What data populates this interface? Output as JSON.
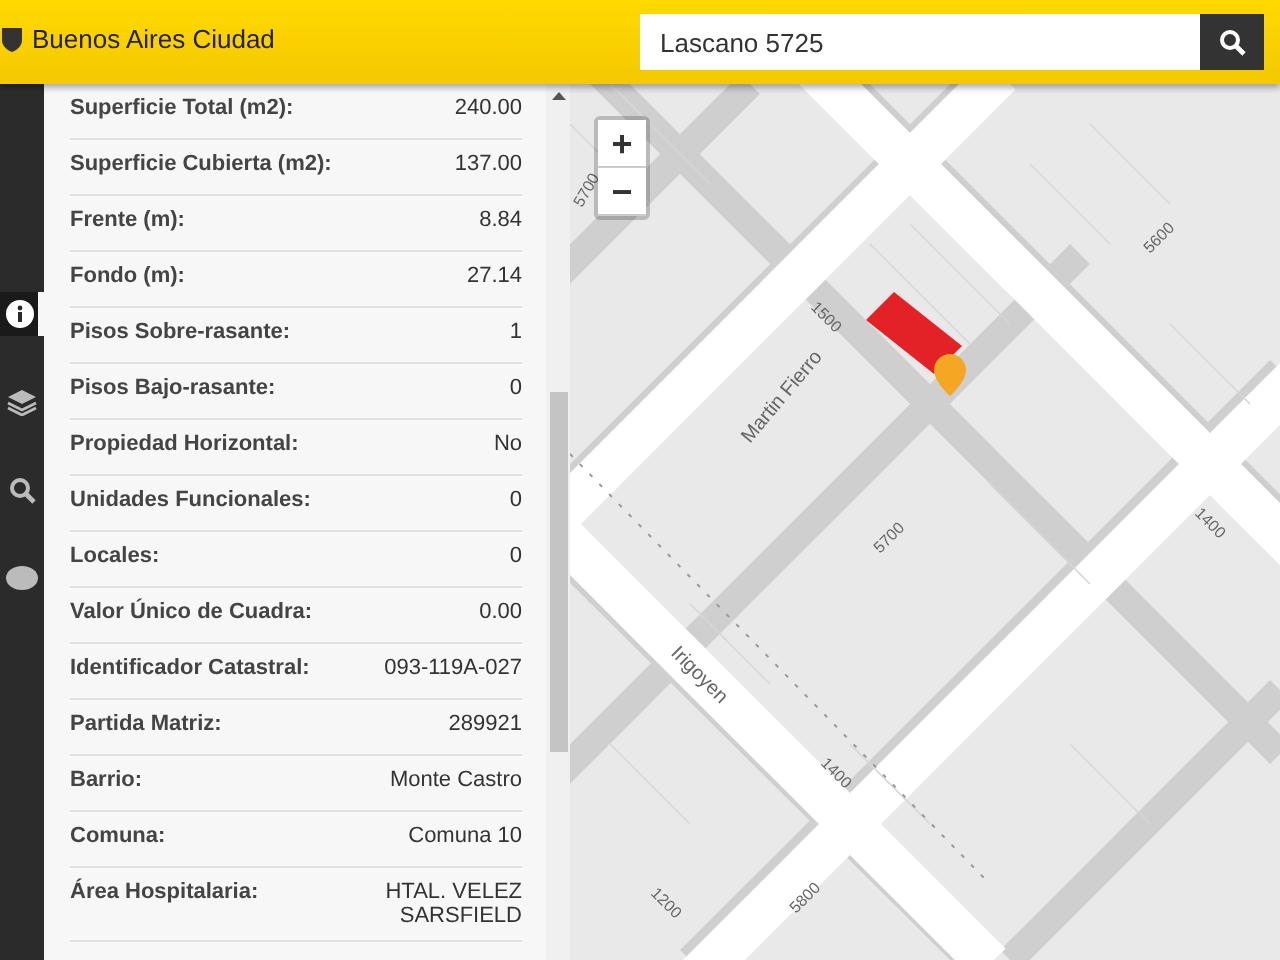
{
  "header": {
    "brand": "Buenos Aires Ciudad",
    "search": {
      "value": "Lascano 5725"
    }
  },
  "sidebar": {
    "tools": [
      {
        "kind": "info",
        "selected": true
      },
      {
        "kind": "layers",
        "selected": false
      },
      {
        "kind": "search",
        "selected": false
      },
      {
        "kind": "chat",
        "selected": false
      }
    ]
  },
  "details": {
    "rows": [
      {
        "label": "Superficie Total (m2):",
        "value": "240.00"
      },
      {
        "label": "Superficie Cubierta (m2):",
        "value": "137.00"
      },
      {
        "label": "Frente (m):",
        "value": "8.84"
      },
      {
        "label": "Fondo (m):",
        "value": "27.14"
      },
      {
        "label": "Pisos Sobre-rasante:",
        "value": "1"
      },
      {
        "label": "Pisos Bajo-rasante:",
        "value": "0"
      },
      {
        "label": "Propiedad Horizontal:",
        "value": "No"
      },
      {
        "label": "Unidades Funcionales:",
        "value": "0"
      },
      {
        "label": "Locales:",
        "value": "0"
      },
      {
        "label": "Valor Único de Cuadra:",
        "value": "0.00"
      },
      {
        "label": "Identificador Catastral:",
        "value": "093-119A-027"
      },
      {
        "label": "Partida Matriz:",
        "value": "289921"
      },
      {
        "label": "Barrio:",
        "value": "Monte Castro"
      },
      {
        "label": "Comuna:",
        "value": "Comuna 10"
      },
      {
        "label": "Área Hospitalaria:",
        "value": "HTAL. VELEZ SARSFIELD"
      }
    ]
  },
  "map": {
    "zoom_in": "+",
    "zoom_out": "−",
    "street_labels": [
      "5700",
      "Martin Fierro",
      "1500",
      "5600",
      "5700",
      "1400",
      "Irigoyen",
      "1400",
      "1200",
      "5800"
    ]
  }
}
